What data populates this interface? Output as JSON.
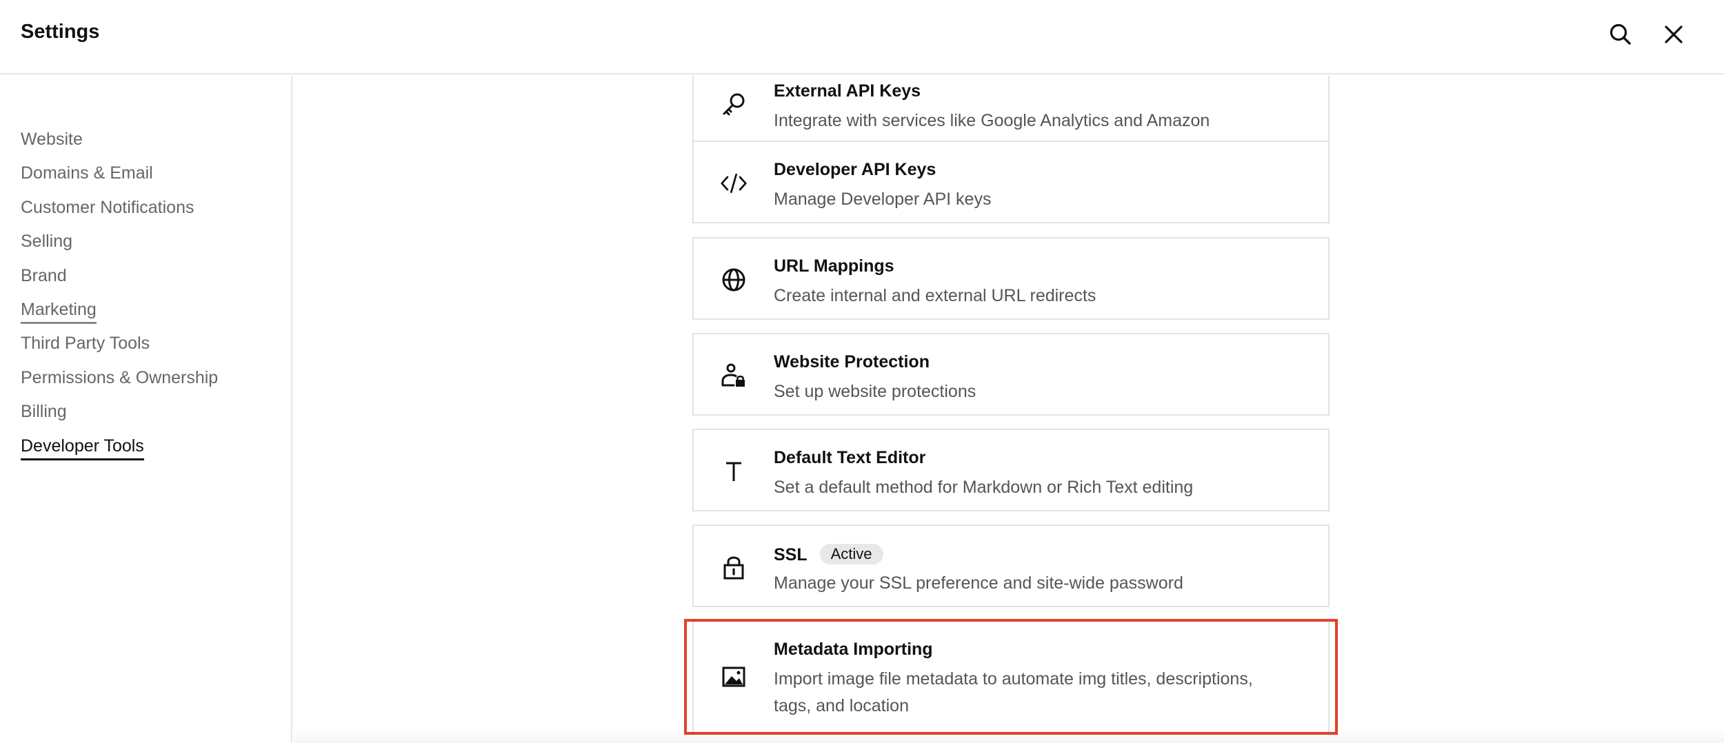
{
  "header": {
    "title": "Settings",
    "search_icon": "search-icon",
    "close_icon": "close-icon"
  },
  "sidebar": {
    "items": [
      {
        "label": "Website"
      },
      {
        "label": "Domains & Email"
      },
      {
        "label": "Customer Notifications"
      },
      {
        "label": "Selling"
      },
      {
        "label": "Brand"
      },
      {
        "label": "Marketing"
      },
      {
        "label": "Third Party Tools"
      },
      {
        "label": "Permissions & Ownership"
      },
      {
        "label": "Billing"
      },
      {
        "label": "Developer Tools",
        "active": true
      }
    ]
  },
  "cards": [
    {
      "title": "External API Keys",
      "desc": "Integrate with services like Google Analytics and Amazon",
      "icon": "key-icon"
    },
    {
      "title": "Developer API Keys",
      "desc": "Manage Developer API keys",
      "icon": "code-icon"
    },
    {
      "title": "URL Mappings",
      "desc": "Create internal and external URL redirects",
      "icon": "globe-icon"
    },
    {
      "title": "Website Protection",
      "desc": "Set up website protections",
      "icon": "user-lock-icon"
    },
    {
      "title": "Default Text Editor",
      "desc": "Set a default method for Markdown or Rich Text editing",
      "icon": "text-icon"
    },
    {
      "title": "SSL",
      "badge": "Active",
      "desc": "Manage your SSL preference and site-wide password",
      "icon": "lock-icon"
    },
    {
      "title": "Metadata Importing",
      "desc": "Import image file metadata to automate img titles, descriptions,",
      "desc2": "tags, and location",
      "icon": "image-icon"
    }
  ],
  "colors": {
    "highlight": "#e2412a",
    "border": "#e3e3e3"
  }
}
